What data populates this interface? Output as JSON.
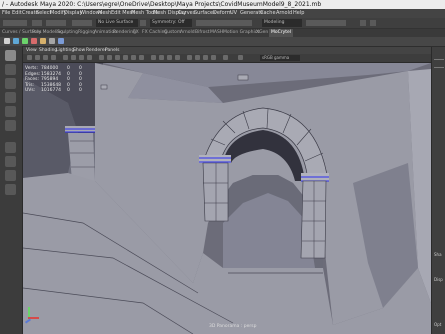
{
  "window": {
    "title": "/ - Autodesk Maya 2020: C:\\Users\\egre\\OneDrive\\Desktop\\Maya Projects\\CovidMuseumModel9_8_2021.mb"
  },
  "menubar": {
    "items": [
      "File",
      "Edit",
      "Create",
      "Select",
      "Modify",
      "Display",
      "Windows",
      "Mesh",
      "Edit Mesh",
      "Mesh Tools",
      "Mesh Display",
      "Curves",
      "Surfaces",
      "Deform",
      "UV",
      "Generate",
      "Cache",
      "Arnold",
      "Help"
    ]
  },
  "statusline": {
    "surface_field": "No Live Surface",
    "symmetry_field": "Symmetry: Off",
    "workspace_field": "Modeling"
  },
  "shelf": {
    "tabs": [
      "Curves / Surfaces",
      "Poly Modeling",
      "Sculpting",
      "Rigging",
      "Animation",
      "Rendering",
      "FX",
      "FX Caching",
      "Custom",
      "Arnold",
      "Bifrost",
      "MASH",
      "Motion Graphics",
      "XGen",
      "MoCrytel"
    ],
    "active_tab": "MoCrytel"
  },
  "panel": {
    "menu": [
      "View",
      "Shading",
      "Lighting",
      "Show",
      "Renderer",
      "Panels"
    ],
    "gamma_field": "sRGB gamma",
    "camera_label": "3D Panorama : persp"
  },
  "hud": {
    "rows": [
      {
        "label": "Verts:",
        "value": "784000",
        "a": "0",
        "b": "0"
      },
      {
        "label": "Edges:",
        "value": "1583274",
        "a": "0",
        "b": "0"
      },
      {
        "label": "Faces:",
        "value": "795894",
        "a": "0",
        "b": "0"
      },
      {
        "label": "Tris:",
        "value": "1538648",
        "a": "0",
        "b": "0"
      },
      {
        "label": "UVs:",
        "value": "1016774",
        "a": "0",
        "b": "0"
      }
    ]
  },
  "right_panel": {
    "labels": [
      "Sha",
      "Disp",
      "Opt"
    ]
  },
  "colors": {
    "viewport_bg": "#6c6c79",
    "wall_light": "#999aa3",
    "wall_dark": "#4b4b58",
    "edge_selection": "#2d2df0",
    "ui_dark": "#444444"
  }
}
